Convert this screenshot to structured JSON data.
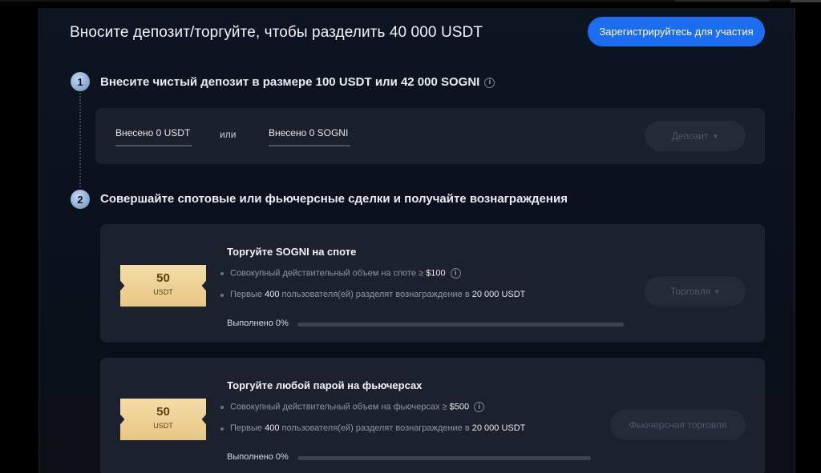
{
  "header": {
    "title": "Вносите депозит/торгуйте, чтобы разделить 40 000 USDT",
    "register_label": "Зарегистрируйтесь для участия"
  },
  "step1": {
    "number": "1",
    "title": "Внесите чистый депозит в размере 100 USDT или 42 000 SOGNI",
    "deposited_usdt": "Внесено 0 USDT",
    "or_label": "или",
    "deposited_sogni": "Внесено 0 SOGNI",
    "deposit_button": "Депозит"
  },
  "step2": {
    "number": "2",
    "title": "Совершайте спотовые или фьючерсные сделки и получайте вознаграждения"
  },
  "tasks": [
    {
      "reward_amount": "50",
      "reward_currency": "USDT",
      "title": "Торгуйте SOGNI на споте",
      "cond1_text": "Совокупный действительный объем на споте ≥ ",
      "cond1_value": "$100",
      "cond2_prefix": "Первые ",
      "cond2_users": "400",
      "cond2_middle": " пользователя(ей) разделят вознаграждение в ",
      "cond2_pool": "20 000 USDT",
      "progress_label": "Выполнено 0%",
      "progress": 0,
      "button_label": "Торговля"
    },
    {
      "reward_amount": "50",
      "reward_currency": "USDT",
      "title": "Торгуйте любой парой на фьючерсах",
      "cond1_text": "Совокупный действительный объем на фьючерсах ≥ ",
      "cond1_value": "$500",
      "cond2_prefix": "Первые ",
      "cond2_users": "400",
      "cond2_middle": " пользователя(ей) разделят вознаграждение в ",
      "cond2_pool": "20 000 USDT",
      "progress_label": "Выполнено 0%",
      "progress": 0,
      "button_label": "Фьючерсная торговля"
    }
  ],
  "icons": {
    "info": "info-icon",
    "caret": "caret-down-icon"
  },
  "colors": {
    "accent": "#1d6df0",
    "ticket": "#f4dca8",
    "card": "#1b222d"
  }
}
